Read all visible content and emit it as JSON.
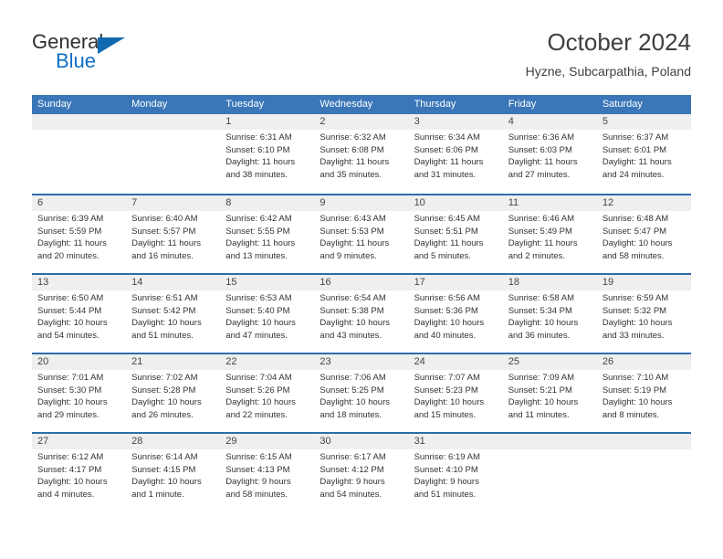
{
  "brand": {
    "name_part1": "General",
    "name_part2": "Blue",
    "triangle_icon": "triangle-icon",
    "accent_color": "#1169b0"
  },
  "header": {
    "title": "October 2024",
    "location": "Hyzne, Subcarpathia, Poland"
  },
  "theme": {
    "header_blue": "#3a76b8",
    "separator_blue": "#2e6ca8",
    "daynum_band": "#efefef"
  },
  "weekdays": [
    "Sunday",
    "Monday",
    "Tuesday",
    "Wednesday",
    "Thursday",
    "Friday",
    "Saturday"
  ],
  "weeks": [
    [
      {
        "day": "",
        "sunrise": "",
        "sunset": "",
        "daylight1": "",
        "daylight2": "",
        "empty": true
      },
      {
        "day": "",
        "sunrise": "",
        "sunset": "",
        "daylight1": "",
        "daylight2": "",
        "empty": true
      },
      {
        "day": "1",
        "sunrise": "Sunrise: 6:31 AM",
        "sunset": "Sunset: 6:10 PM",
        "daylight1": "Daylight: 11 hours",
        "daylight2": "and 38 minutes."
      },
      {
        "day": "2",
        "sunrise": "Sunrise: 6:32 AM",
        "sunset": "Sunset: 6:08 PM",
        "daylight1": "Daylight: 11 hours",
        "daylight2": "and 35 minutes."
      },
      {
        "day": "3",
        "sunrise": "Sunrise: 6:34 AM",
        "sunset": "Sunset: 6:06 PM",
        "daylight1": "Daylight: 11 hours",
        "daylight2": "and 31 minutes."
      },
      {
        "day": "4",
        "sunrise": "Sunrise: 6:36 AM",
        "sunset": "Sunset: 6:03 PM",
        "daylight1": "Daylight: 11 hours",
        "daylight2": "and 27 minutes."
      },
      {
        "day": "5",
        "sunrise": "Sunrise: 6:37 AM",
        "sunset": "Sunset: 6:01 PM",
        "daylight1": "Daylight: 11 hours",
        "daylight2": "and 24 minutes."
      }
    ],
    [
      {
        "day": "6",
        "sunrise": "Sunrise: 6:39 AM",
        "sunset": "Sunset: 5:59 PM",
        "daylight1": "Daylight: 11 hours",
        "daylight2": "and 20 minutes."
      },
      {
        "day": "7",
        "sunrise": "Sunrise: 6:40 AM",
        "sunset": "Sunset: 5:57 PM",
        "daylight1": "Daylight: 11 hours",
        "daylight2": "and 16 minutes."
      },
      {
        "day": "8",
        "sunrise": "Sunrise: 6:42 AM",
        "sunset": "Sunset: 5:55 PM",
        "daylight1": "Daylight: 11 hours",
        "daylight2": "and 13 minutes."
      },
      {
        "day": "9",
        "sunrise": "Sunrise: 6:43 AM",
        "sunset": "Sunset: 5:53 PM",
        "daylight1": "Daylight: 11 hours",
        "daylight2": "and 9 minutes."
      },
      {
        "day": "10",
        "sunrise": "Sunrise: 6:45 AM",
        "sunset": "Sunset: 5:51 PM",
        "daylight1": "Daylight: 11 hours",
        "daylight2": "and 5 minutes."
      },
      {
        "day": "11",
        "sunrise": "Sunrise: 6:46 AM",
        "sunset": "Sunset: 5:49 PM",
        "daylight1": "Daylight: 11 hours",
        "daylight2": "and 2 minutes."
      },
      {
        "day": "12",
        "sunrise": "Sunrise: 6:48 AM",
        "sunset": "Sunset: 5:47 PM",
        "daylight1": "Daylight: 10 hours",
        "daylight2": "and 58 minutes."
      }
    ],
    [
      {
        "day": "13",
        "sunrise": "Sunrise: 6:50 AM",
        "sunset": "Sunset: 5:44 PM",
        "daylight1": "Daylight: 10 hours",
        "daylight2": "and 54 minutes."
      },
      {
        "day": "14",
        "sunrise": "Sunrise: 6:51 AM",
        "sunset": "Sunset: 5:42 PM",
        "daylight1": "Daylight: 10 hours",
        "daylight2": "and 51 minutes."
      },
      {
        "day": "15",
        "sunrise": "Sunrise: 6:53 AM",
        "sunset": "Sunset: 5:40 PM",
        "daylight1": "Daylight: 10 hours",
        "daylight2": "and 47 minutes."
      },
      {
        "day": "16",
        "sunrise": "Sunrise: 6:54 AM",
        "sunset": "Sunset: 5:38 PM",
        "daylight1": "Daylight: 10 hours",
        "daylight2": "and 43 minutes."
      },
      {
        "day": "17",
        "sunrise": "Sunrise: 6:56 AM",
        "sunset": "Sunset: 5:36 PM",
        "daylight1": "Daylight: 10 hours",
        "daylight2": "and 40 minutes."
      },
      {
        "day": "18",
        "sunrise": "Sunrise: 6:58 AM",
        "sunset": "Sunset: 5:34 PM",
        "daylight1": "Daylight: 10 hours",
        "daylight2": "and 36 minutes."
      },
      {
        "day": "19",
        "sunrise": "Sunrise: 6:59 AM",
        "sunset": "Sunset: 5:32 PM",
        "daylight1": "Daylight: 10 hours",
        "daylight2": "and 33 minutes."
      }
    ],
    [
      {
        "day": "20",
        "sunrise": "Sunrise: 7:01 AM",
        "sunset": "Sunset: 5:30 PM",
        "daylight1": "Daylight: 10 hours",
        "daylight2": "and 29 minutes."
      },
      {
        "day": "21",
        "sunrise": "Sunrise: 7:02 AM",
        "sunset": "Sunset: 5:28 PM",
        "daylight1": "Daylight: 10 hours",
        "daylight2": "and 26 minutes."
      },
      {
        "day": "22",
        "sunrise": "Sunrise: 7:04 AM",
        "sunset": "Sunset: 5:26 PM",
        "daylight1": "Daylight: 10 hours",
        "daylight2": "and 22 minutes."
      },
      {
        "day": "23",
        "sunrise": "Sunrise: 7:06 AM",
        "sunset": "Sunset: 5:25 PM",
        "daylight1": "Daylight: 10 hours",
        "daylight2": "and 18 minutes."
      },
      {
        "day": "24",
        "sunrise": "Sunrise: 7:07 AM",
        "sunset": "Sunset: 5:23 PM",
        "daylight1": "Daylight: 10 hours",
        "daylight2": "and 15 minutes."
      },
      {
        "day": "25",
        "sunrise": "Sunrise: 7:09 AM",
        "sunset": "Sunset: 5:21 PM",
        "daylight1": "Daylight: 10 hours",
        "daylight2": "and 11 minutes."
      },
      {
        "day": "26",
        "sunrise": "Sunrise: 7:10 AM",
        "sunset": "Sunset: 5:19 PM",
        "daylight1": "Daylight: 10 hours",
        "daylight2": "and 8 minutes."
      }
    ],
    [
      {
        "day": "27",
        "sunrise": "Sunrise: 6:12 AM",
        "sunset": "Sunset: 4:17 PM",
        "daylight1": "Daylight: 10 hours",
        "daylight2": "and 4 minutes."
      },
      {
        "day": "28",
        "sunrise": "Sunrise: 6:14 AM",
        "sunset": "Sunset: 4:15 PM",
        "daylight1": "Daylight: 10 hours",
        "daylight2": "and 1 minute."
      },
      {
        "day": "29",
        "sunrise": "Sunrise: 6:15 AM",
        "sunset": "Sunset: 4:13 PM",
        "daylight1": "Daylight: 9 hours",
        "daylight2": "and 58 minutes."
      },
      {
        "day": "30",
        "sunrise": "Sunrise: 6:17 AM",
        "sunset": "Sunset: 4:12 PM",
        "daylight1": "Daylight: 9 hours",
        "daylight2": "and 54 minutes."
      },
      {
        "day": "31",
        "sunrise": "Sunrise: 6:19 AM",
        "sunset": "Sunset: 4:10 PM",
        "daylight1": "Daylight: 9 hours",
        "daylight2": "and 51 minutes."
      },
      {
        "day": "",
        "sunrise": "",
        "sunset": "",
        "daylight1": "",
        "daylight2": "",
        "empty": true
      },
      {
        "day": "",
        "sunrise": "",
        "sunset": "",
        "daylight1": "",
        "daylight2": "",
        "empty": true
      }
    ]
  ]
}
